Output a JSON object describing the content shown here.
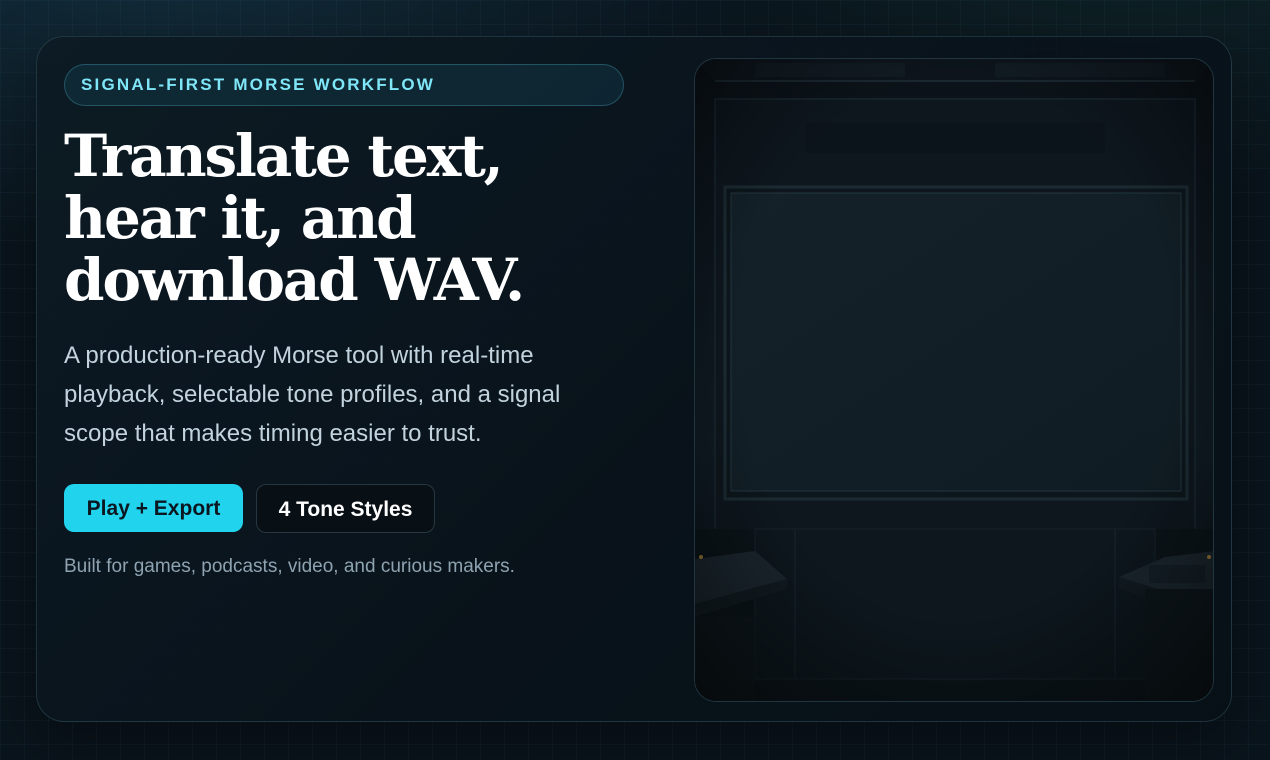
{
  "hero": {
    "eyebrow": "SIGNAL-FIRST MORSE WORKFLOW",
    "title_lines": [
      "Translate text,",
      "hear it, and",
      "download WAV."
    ],
    "description": "A production-ready Morse tool with real-time playback, selectable tone profiles, and a signal scope that makes timing easier to trust.",
    "primary_button": "Play + Export",
    "secondary_button": "4 Tone Styles",
    "note": "Built for games, podcasts, video, and curious makers."
  },
  "media": {
    "icon": "radio-room-illustration"
  },
  "colors": {
    "accent": "#22d3ee",
    "eyebrow_text": "#7fe6f8",
    "background": "#0a141c",
    "card": "#0d1b24"
  }
}
